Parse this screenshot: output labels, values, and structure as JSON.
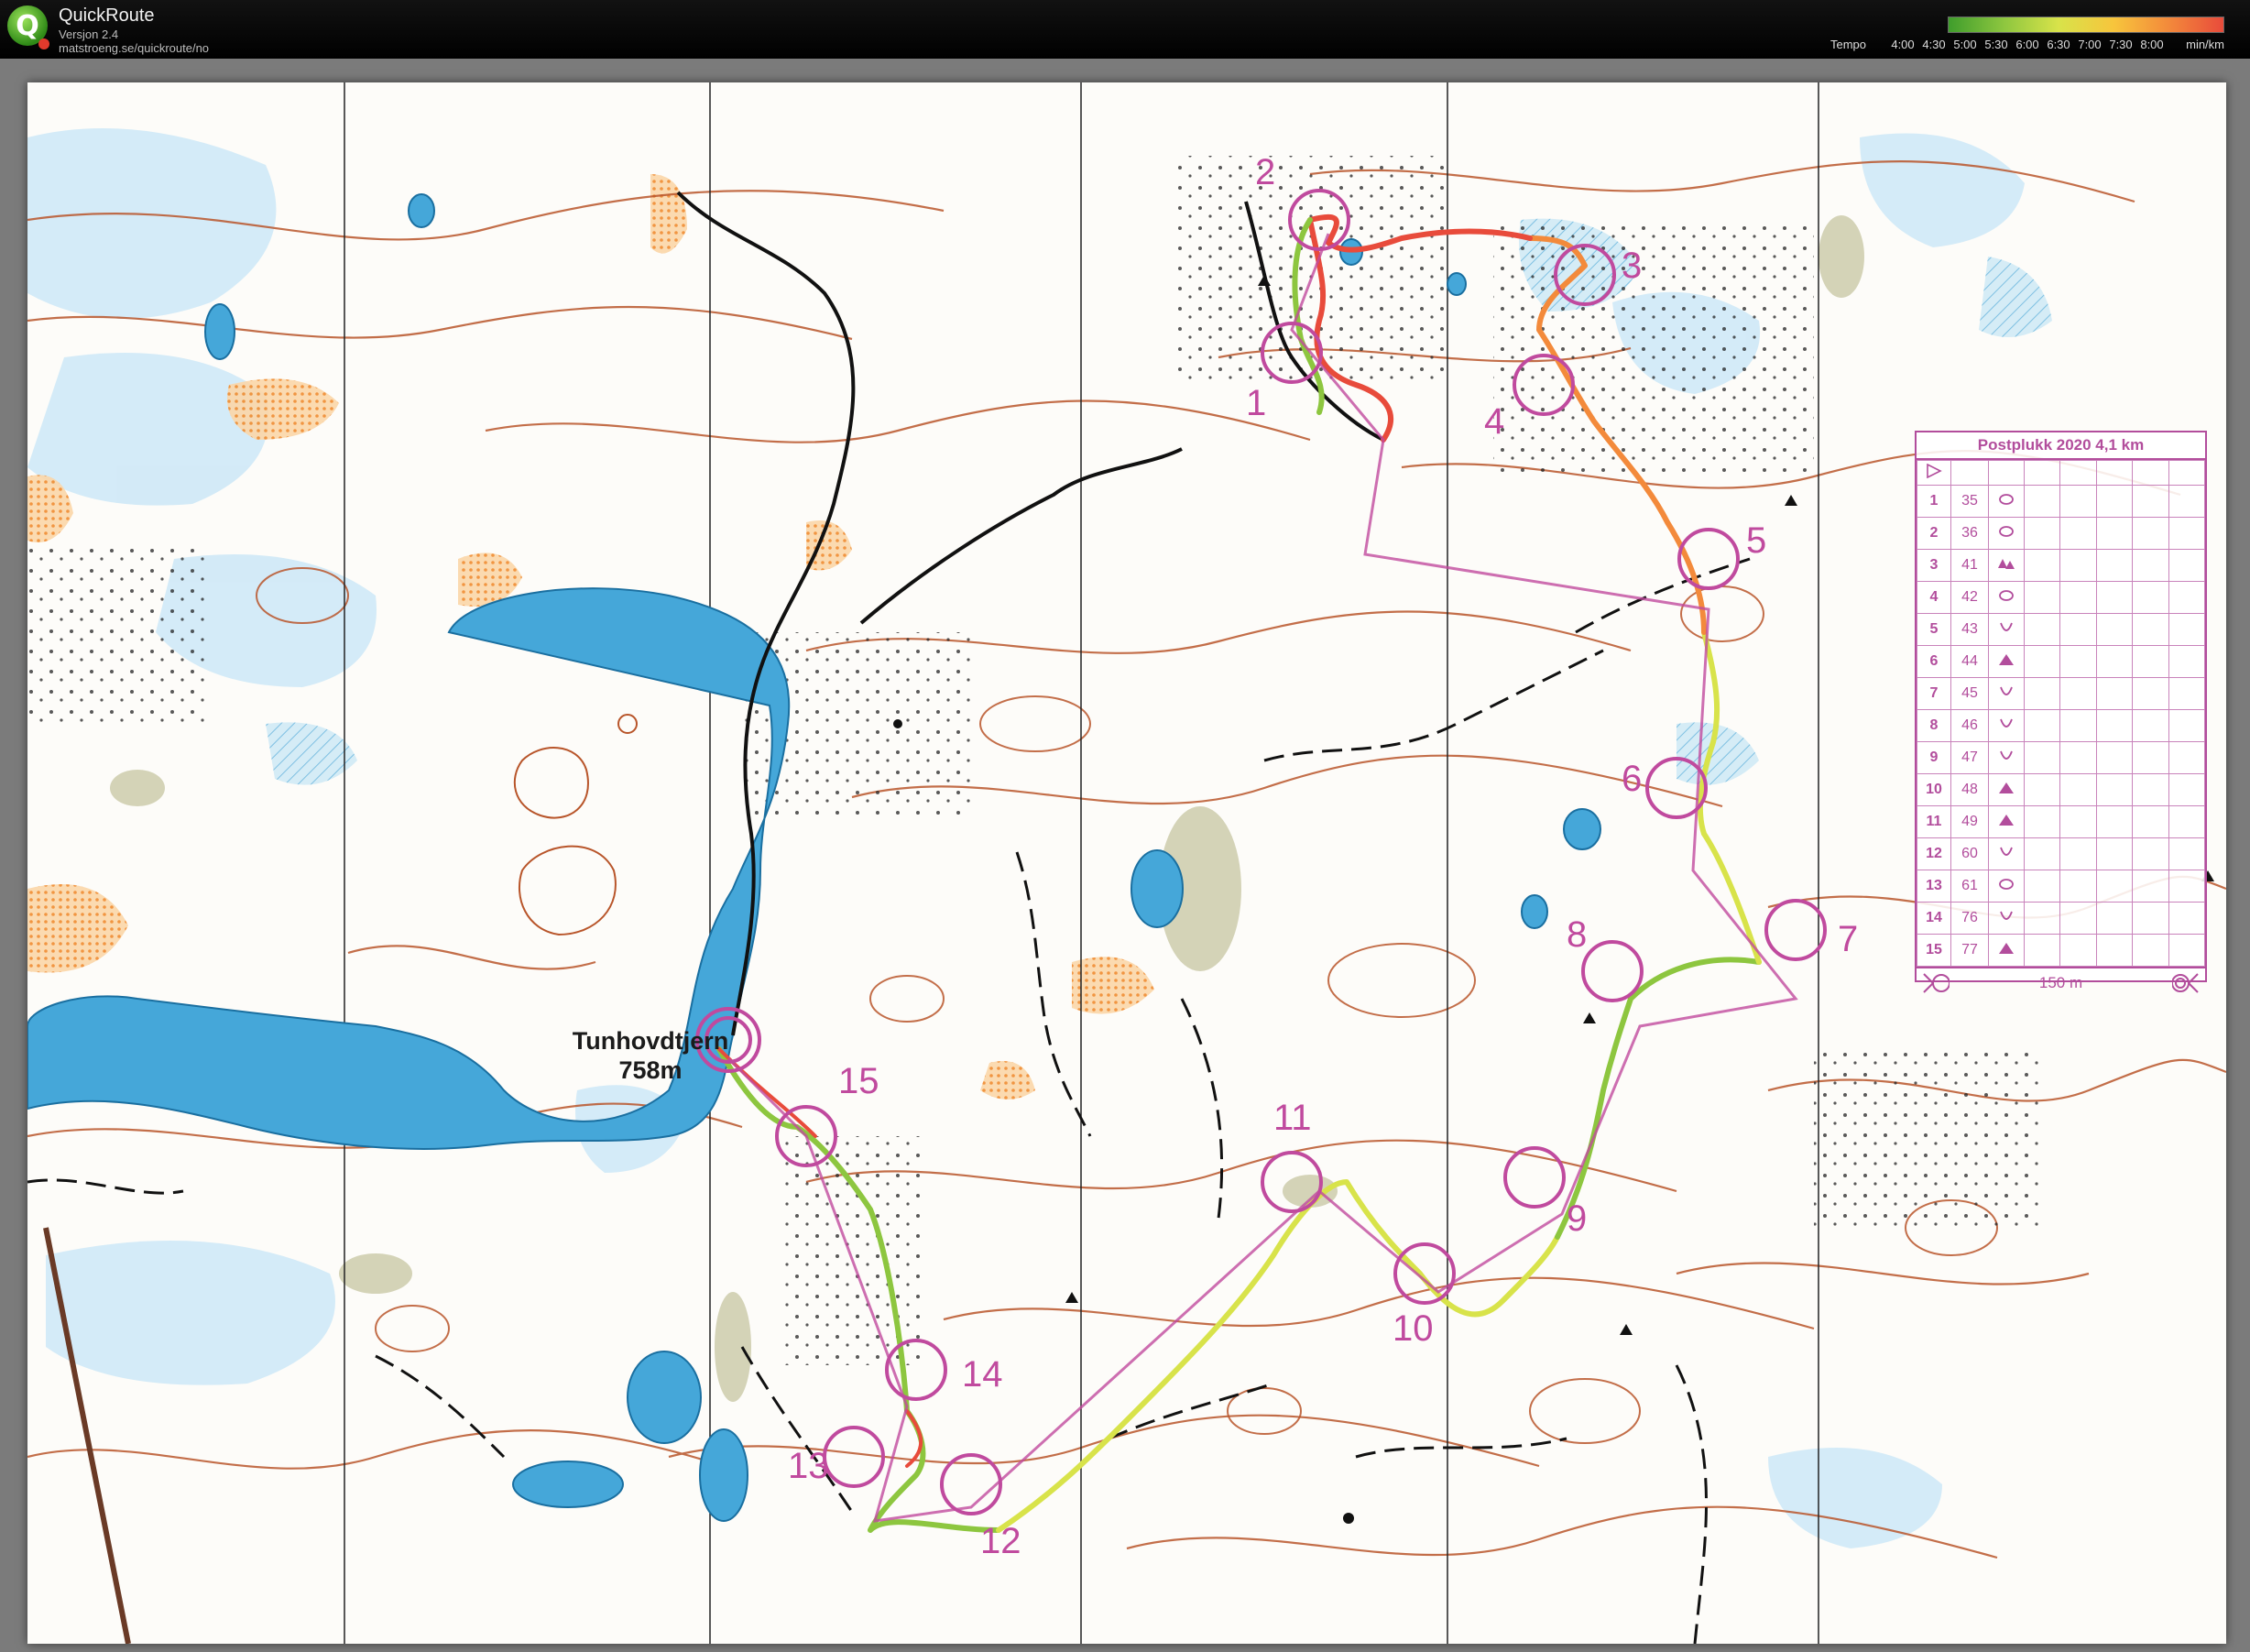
{
  "header": {
    "app_name": "QuickRoute",
    "version": "Versjon 2.4",
    "url": "matstroeng.se/quickroute/no",
    "logo_letter": "Q"
  },
  "legend": {
    "label": "Tempo",
    "ticks": [
      "4:00",
      "4:30",
      "5:00",
      "5:30",
      "6:00",
      "6:30",
      "7:00",
      "7:30",
      "8:00"
    ],
    "unit": "min/km",
    "colors": [
      "#3f9d2c",
      "#8dc63f",
      "#d8e34a",
      "#f7c53c",
      "#f38a3b",
      "#e84b3b"
    ]
  },
  "map": {
    "lake_name": "Tunhovdtjern",
    "lake_elevation": "758m",
    "control_numbers": [
      "1",
      "2",
      "3",
      "4",
      "5",
      "6",
      "7",
      "8",
      "9",
      "10",
      "11",
      "12",
      "13",
      "14",
      "15"
    ]
  },
  "control_card": {
    "title": "Postplukk 2020 4,1 km",
    "rows": [
      {
        "n": "1",
        "code": "35",
        "sym": "knoll"
      },
      {
        "n": "2",
        "code": "36",
        "sym": "knoll"
      },
      {
        "n": "3",
        "code": "41",
        "sym": "boulder-field"
      },
      {
        "n": "4",
        "code": "42",
        "sym": "knoll"
      },
      {
        "n": "5",
        "code": "43",
        "sym": "depression"
      },
      {
        "n": "6",
        "code": "44",
        "sym": "boulder"
      },
      {
        "n": "7",
        "code": "45",
        "sym": "depression"
      },
      {
        "n": "8",
        "code": "46",
        "sym": "depression"
      },
      {
        "n": "9",
        "code": "47",
        "sym": "depression"
      },
      {
        "n": "10",
        "code": "48",
        "sym": "boulder"
      },
      {
        "n": "11",
        "code": "49",
        "sym": "boulder"
      },
      {
        "n": "12",
        "code": "60",
        "sym": "depression"
      },
      {
        "n": "13",
        "code": "61",
        "sym": "knoll"
      },
      {
        "n": "14",
        "code": "76",
        "sym": "depression"
      },
      {
        "n": "15",
        "code": "77",
        "sym": "boulder"
      }
    ],
    "finish_text": "150 m"
  }
}
